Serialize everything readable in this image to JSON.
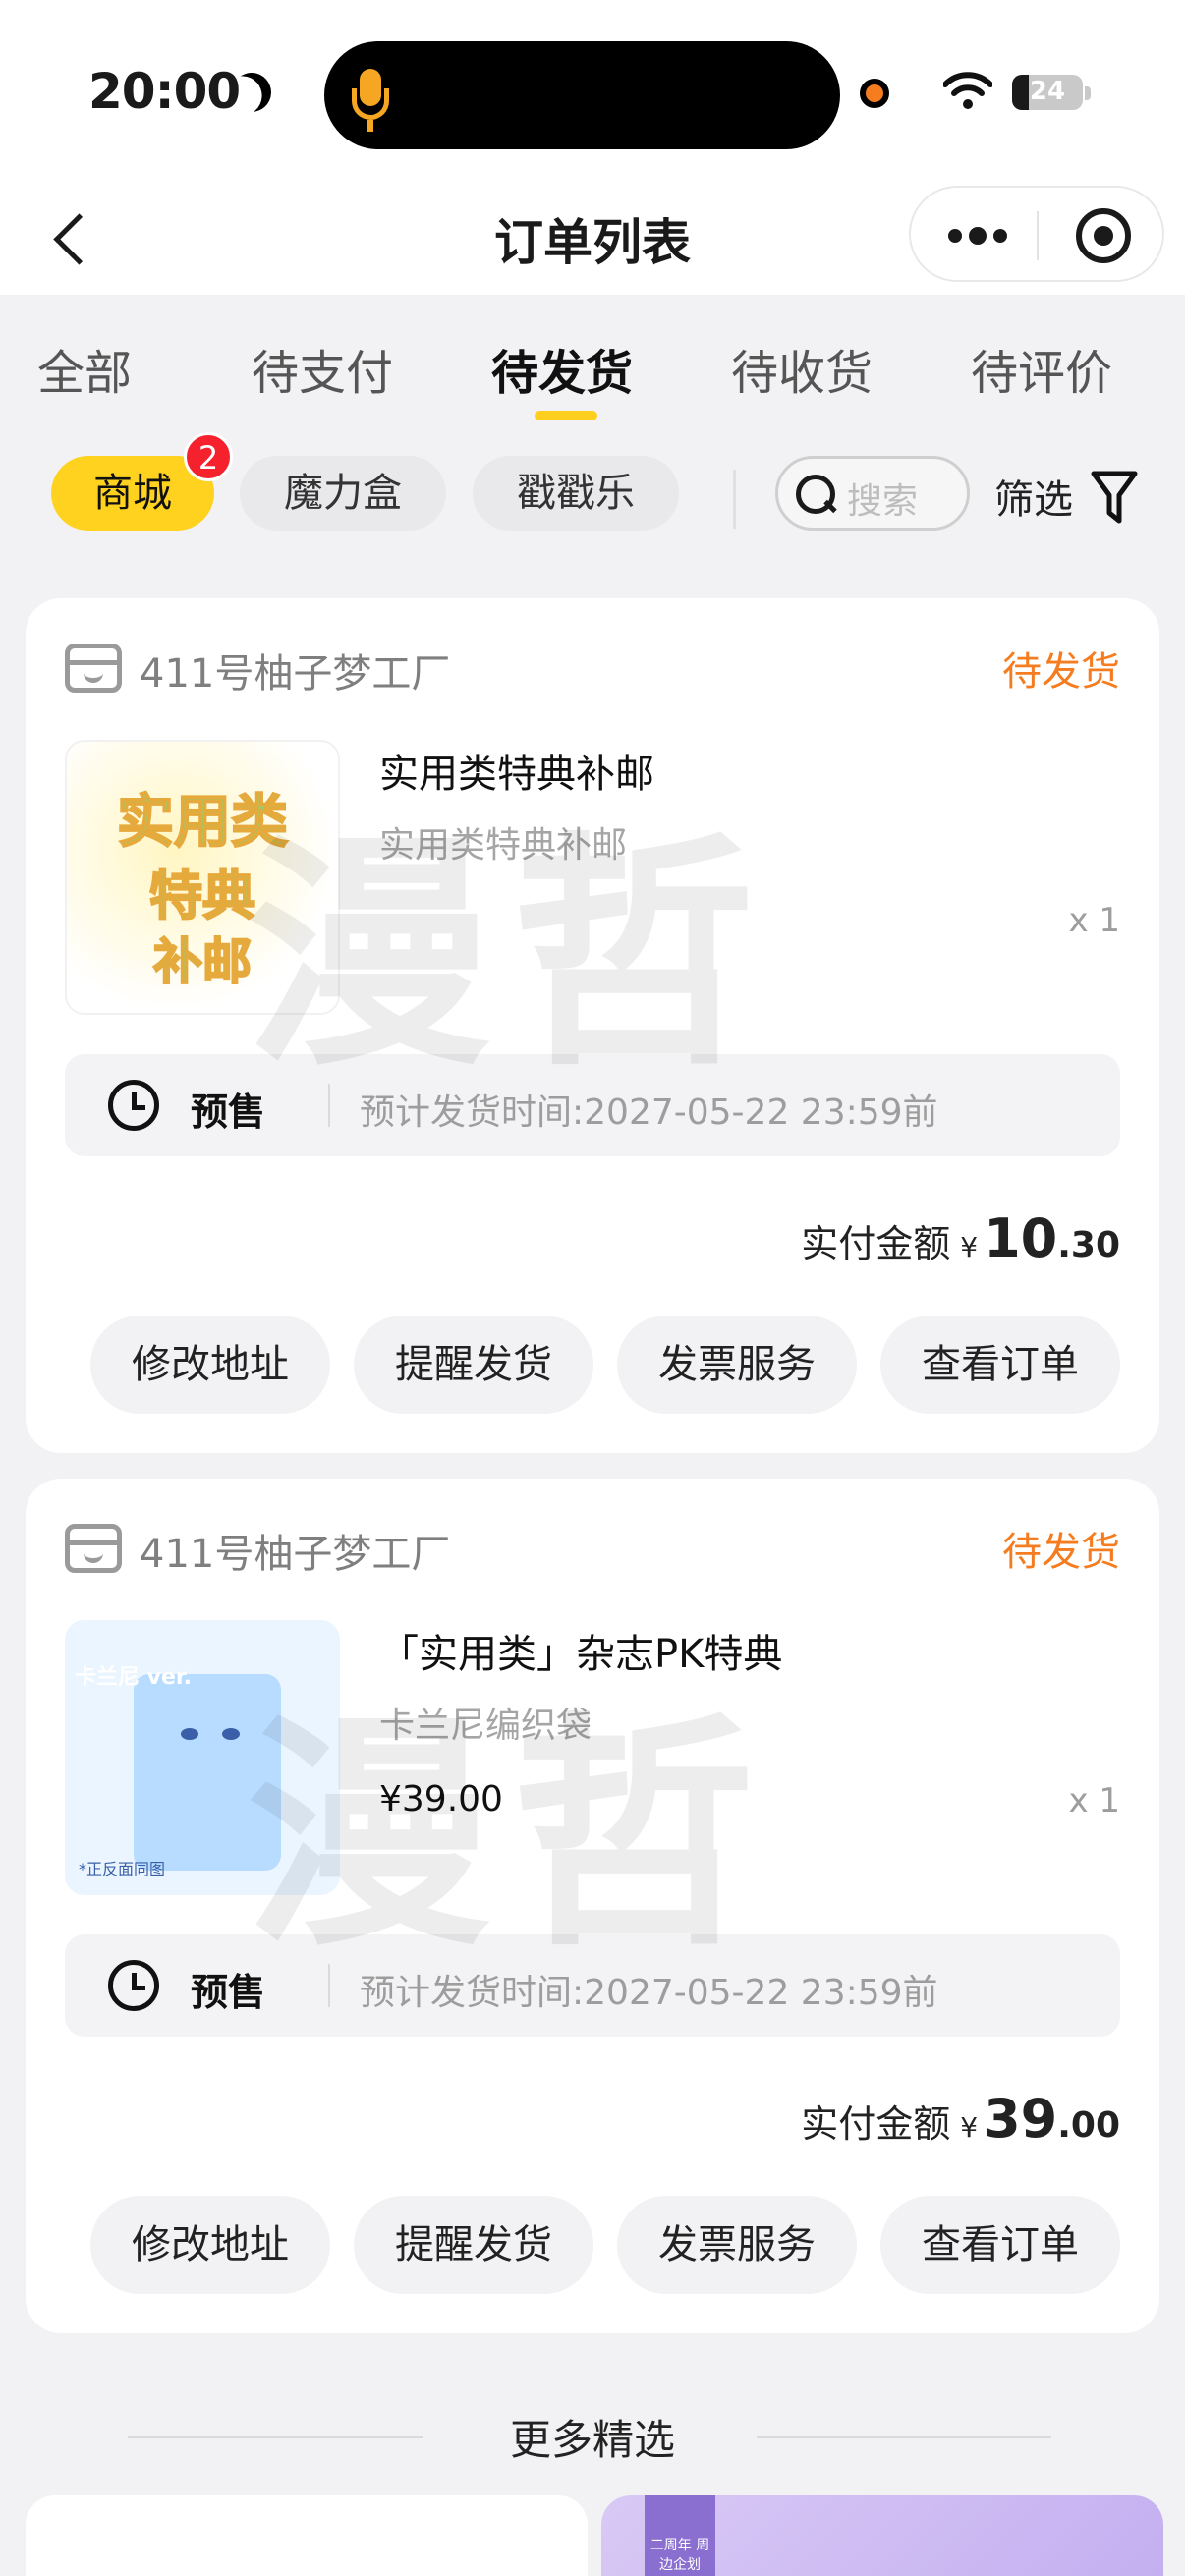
{
  "status_bar": {
    "time": "20:00",
    "battery_text": "24",
    "battery_level": 0.24
  },
  "nav": {
    "title": "订单列表"
  },
  "tabs": [
    {
      "label": "全部"
    },
    {
      "label": "待支付"
    },
    {
      "label": "待发货"
    },
    {
      "label": "待收货"
    },
    {
      "label": "待评价"
    }
  ],
  "active_tab": "待发货",
  "chips": [
    {
      "label": "商城",
      "badge": "2"
    },
    {
      "label": "魔力盒"
    },
    {
      "label": "戳戳乐"
    }
  ],
  "search": {
    "placeholder": "搜索"
  },
  "filter": {
    "label": "筛选"
  },
  "watermark": "漫哲",
  "orders": [
    {
      "shop": "411号柚子梦工厂",
      "status": "待发货",
      "thumb_lines": [
        "实用类",
        "特典",
        "补邮"
      ],
      "title": "实用类特典补邮",
      "subtitle": "实用类特典补邮",
      "price": "",
      "qty": "x 1",
      "presale_tag": "预售",
      "presale_time": "预计发货时间:2027-05-22 23:59前",
      "paid_label": "实付金额",
      "currency": "¥",
      "paid_int": "10",
      "paid_dec": ".30",
      "buttons": [
        "修改地址",
        "提醒发货",
        "发票服务",
        "查看订单"
      ]
    },
    {
      "shop": "411号柚子梦工厂",
      "status": "待发货",
      "thumb_label": "卡兰尼 ver.",
      "thumb_footer": "*正反面同图",
      "title": "「实用类」杂志PK特典",
      "subtitle": "卡兰尼编织袋",
      "price": "¥39.00",
      "qty": "x 1",
      "presale_tag": "预售",
      "presale_time": "预计发货时间:2027-05-22 23:59前",
      "paid_label": "实付金额",
      "currency": "¥",
      "paid_int": "39",
      "paid_dec": ".00",
      "buttons": [
        "修改地址",
        "提醒发货",
        "发票服务",
        "查看订单"
      ]
    }
  ],
  "more": {
    "title": "更多精选",
    "card_b_text": "二周年 周边企划"
  },
  "colors": {
    "accent": "#ffd21f",
    "status": "#f57c1f",
    "badge": "#f5222d"
  }
}
